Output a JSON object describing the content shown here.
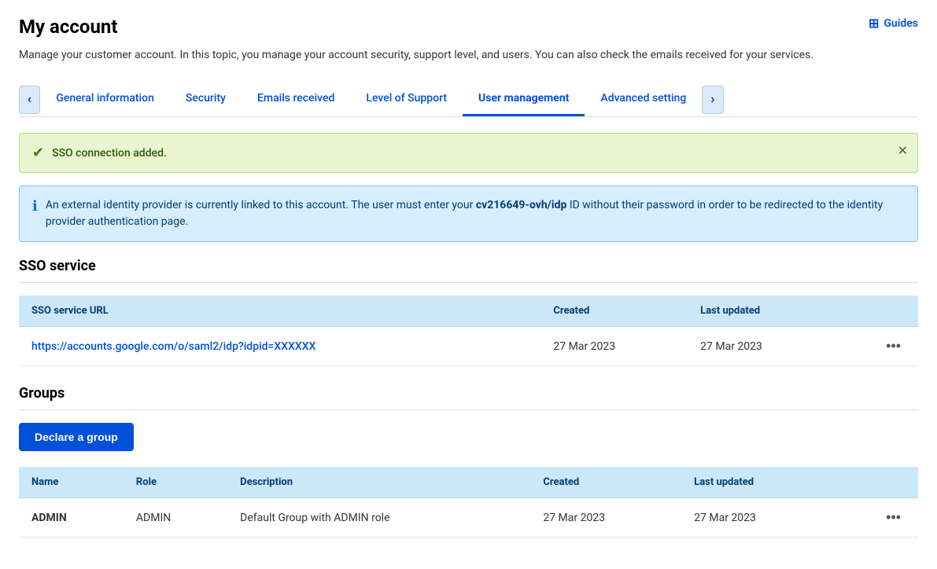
{
  "page": {
    "title": "My account",
    "description": "Manage your customer account. In this topic, you manage your account security, support level, and users. You can also check the emails received for your services.",
    "guides_label": "Guides"
  },
  "tabs": [
    {
      "id": "general",
      "label": "General information",
      "active": false
    },
    {
      "id": "security",
      "label": "Security",
      "active": false
    },
    {
      "id": "emails",
      "label": "Emails received",
      "active": false
    },
    {
      "id": "support",
      "label": "Level of Support",
      "active": false
    },
    {
      "id": "usermgmt",
      "label": "User management",
      "active": true
    },
    {
      "id": "advanced",
      "label": "Advanced setting",
      "active": false
    }
  ],
  "alerts": {
    "success": {
      "text": "SSO connection added."
    },
    "info": {
      "text_before": "An external identity provider is currently linked to this account. The user must enter your ",
      "highlight": "cv216649-ovh/idp",
      "text_after": " ID without their password in order to be redirected to the identity provider authentication page."
    }
  },
  "sso_section": {
    "title": "SSO service",
    "table": {
      "headers": [
        "SSO service URL",
        "Created",
        "Last updated",
        ""
      ],
      "rows": [
        {
          "url": "https://accounts.google.com/o/saml2/idp?idpid=XXXXXX",
          "created": "27 Mar 2023",
          "last_updated": "27 Mar 2023"
        }
      ]
    }
  },
  "groups_section": {
    "title": "Groups",
    "declare_button": "Declare a group",
    "table": {
      "headers": [
        "Name",
        "Role",
        "Description",
        "Created",
        "Last updated",
        ""
      ],
      "rows": [
        {
          "name": "ADMIN",
          "role": "ADMIN",
          "description": "Default Group with ADMIN role",
          "created": "27 Mar 2023",
          "last_updated": "27 Mar 2023"
        }
      ]
    }
  },
  "icons": {
    "prev": "‹",
    "next": "›",
    "check_circle": "✓",
    "info_circle": "ℹ",
    "close": "✕",
    "ellipsis": "•••",
    "guides_grid": "⊞"
  }
}
